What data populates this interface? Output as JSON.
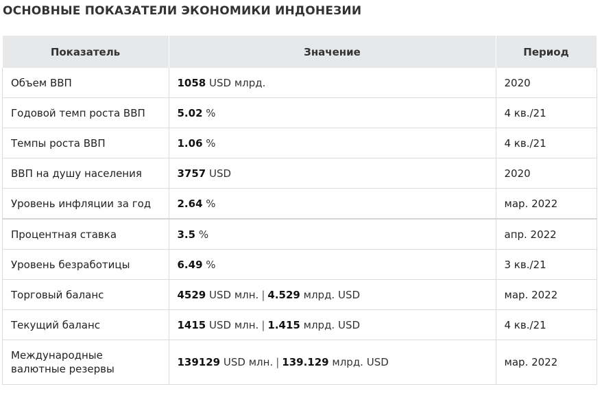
{
  "title": "ОСНОВНЫЕ ПОКАЗАТЕЛИ ЭКОНОМИКИ ИНДОНЕЗИИ",
  "table": {
    "headers": [
      "Показатель",
      "Значение",
      "Период"
    ],
    "rows": [
      {
        "name": "Объем ВВП",
        "v1": "1058",
        "u1": "USD млрд.",
        "v2": "",
        "u2": "",
        "period": "2020"
      },
      {
        "name": "Годовой темп роста ВВП",
        "v1": "5.02",
        "u1": "%",
        "v2": "",
        "u2": "",
        "period": "4 кв./21"
      },
      {
        "name": "Темпы роста ВВП",
        "v1": "1.06",
        "u1": "%",
        "v2": "",
        "u2": "",
        "period": "4 кв./21"
      },
      {
        "name": "ВВП на душу населения",
        "v1": "3757",
        "u1": "USD",
        "v2": "",
        "u2": "",
        "period": "2020"
      },
      {
        "name": "Уровень инфляции за год",
        "v1": "2.64",
        "u1": "%",
        "v2": "",
        "u2": "",
        "period": "мар. 2022"
      },
      {
        "name": "Процентная ставка",
        "v1": "3.5",
        "u1": "%",
        "v2": "",
        "u2": "",
        "period": "апр. 2022"
      },
      {
        "name": "Уровень безработицы",
        "v1": "6.49",
        "u1": "%",
        "v2": "",
        "u2": "",
        "period": "3 кв./21"
      },
      {
        "name": "Торговый баланс",
        "v1": "4529",
        "u1": "USD млн.",
        "v2": "4.529",
        "u2": "млрд. USD",
        "period": "мар. 2022"
      },
      {
        "name": "Текущий баланс",
        "v1": "1415",
        "u1": "USD млн.",
        "v2": "1.415",
        "u2": "млрд. USD",
        "period": "4 кв./21"
      },
      {
        "name": "Международные валютные резервы",
        "v1": "139129",
        "u1": "USD млн.",
        "v2": "139.129",
        "u2": "млрд. USD",
        "period": "мар. 2022"
      }
    ],
    "separator": "|"
  }
}
